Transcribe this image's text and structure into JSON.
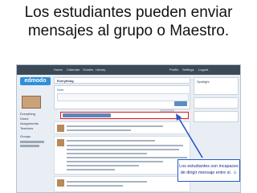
{
  "slide": {
    "title_line1": "Los estudiantes pueden enviar",
    "title_line2": "mensajes al grupo o Maestro."
  },
  "app": {
    "brand": "edmodo",
    "nav_links": [
      "Home",
      "Calendar",
      "Grades",
      "Library"
    ],
    "right_links": [
      "Profile",
      "Settings",
      "Logout"
    ]
  },
  "group": {
    "name": "Everything"
  },
  "sidebar": {
    "labels": [
      "Everything",
      "Direct",
      "Assignments",
      "Teachers",
      "Groups"
    ]
  },
  "post_box": {
    "tabs": "Note"
  },
  "right_panel": {
    "title": "Spotlight"
  },
  "callout": {
    "line1": "Los estudiantes son incapaces",
    "line2": "de dirigir mensaje entre sí. ☺"
  },
  "colors": {
    "accent": "#2f8fd8",
    "highlight": "#e01b1b",
    "callout": "#2857c7"
  }
}
